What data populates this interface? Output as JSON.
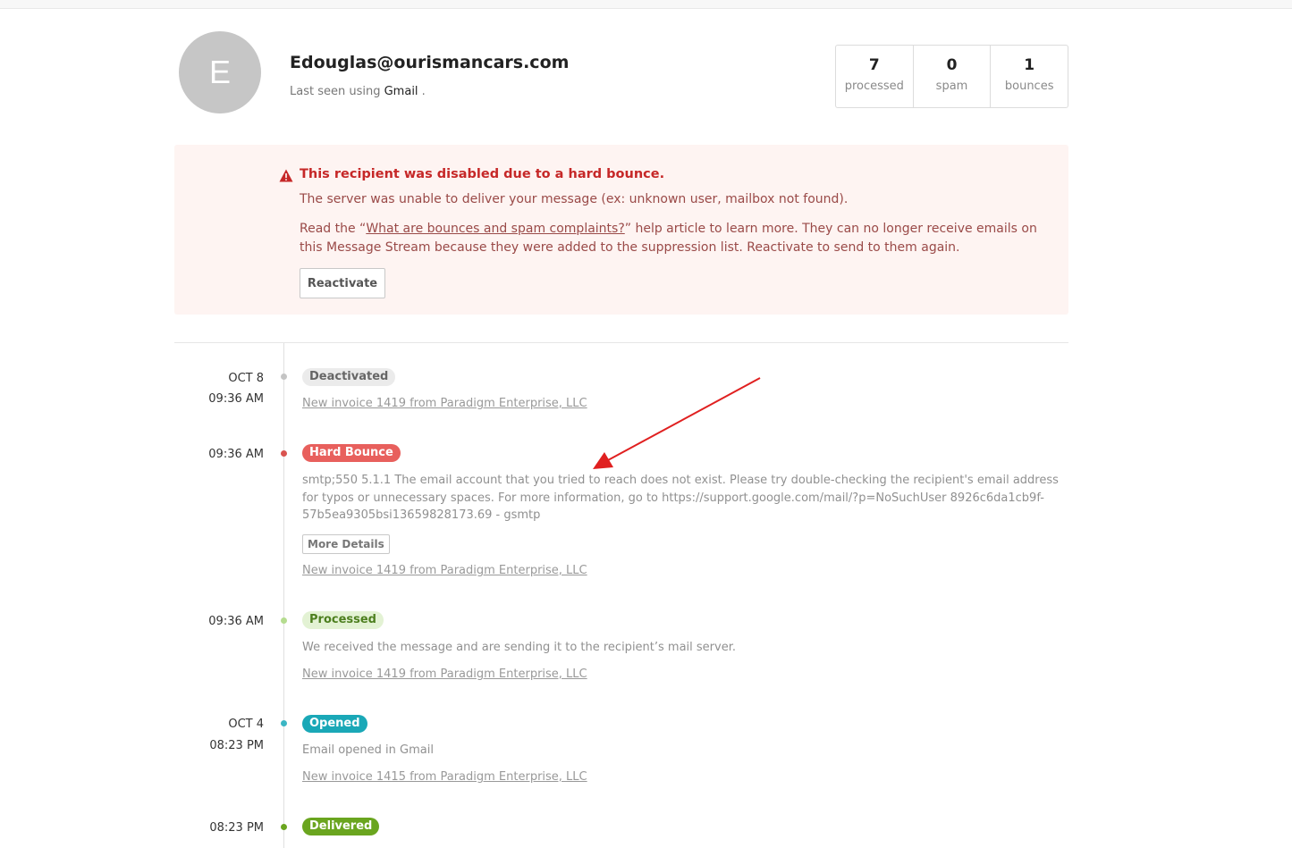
{
  "profile": {
    "avatar_letter": "E",
    "email": "Edouglas@ourismancars.com",
    "last_seen_prefix": "Last seen using",
    "last_seen_client": "Gmail",
    "last_seen_suffix": " ."
  },
  "stats": [
    {
      "value": "7",
      "label": "processed"
    },
    {
      "value": "0",
      "label": "spam"
    },
    {
      "value": "1",
      "label": "bounces"
    }
  ],
  "alert": {
    "icon": "warning-triangle-icon",
    "title": "This recipient was disabled due to a hard bounce.",
    "line1": "The server was unable to deliver your message (ex: unknown user, mailbox not found).",
    "line2_prefix": "Read the “",
    "line2_link": "What are bounces and spam complaints?",
    "line2_suffix": "” help article to learn more. They can no longer receive emails on this Message Stream because they were added to the suppression list. Reactivate to send to them again.",
    "button": "Reactivate",
    "colors": {
      "background": "#fef4f2",
      "title": "#c62828",
      "text": "#9a4a48"
    }
  },
  "timeline": [
    {
      "date": "OCT 8",
      "time": "09:36 AM",
      "badge": "Deactivated",
      "badge_color": "#ebebeb",
      "dot_color": "#c4c4c4",
      "link": "New invoice 1419 from Paradigm Enterprise, LLC"
    },
    {
      "time": "09:36 AM",
      "badge": "Hard Bounce",
      "badge_color": "#e8605d",
      "dot_color": "#d9534f",
      "description": "smtp;550 5.1.1 The email account that you tried to reach does not exist. Please try double-checking the recipient's email address for typos or unnecessary spaces. For more information, go to https://support.google.com/mail/?p=NoSuchUser 8926c6da1cb9f-57b5ea9305bsi13659828173.69 - gsmtp",
      "button": "More Details",
      "link": "New invoice 1419 from Paradigm Enterprise, LLC"
    },
    {
      "time": "09:36 AM",
      "badge": "Processed",
      "badge_color": "#e3f2d4",
      "dot_color": "#b5dc8f",
      "description": "We received the message and are sending it to the recipient’s mail server.",
      "link": "New invoice 1419 from Paradigm Enterprise, LLC"
    },
    {
      "date": "OCT 4",
      "time": "08:23 PM",
      "badge": "Opened",
      "badge_color": "#1aa8b7",
      "dot_color": "#3bb6c4",
      "description": "Email opened in Gmail",
      "link": "New invoice 1415 from Paradigm Enterprise, LLC"
    },
    {
      "time": "08:23 PM",
      "badge": "Delivered",
      "badge_color": "#6aa51f",
      "dot_color": "#6aa51f"
    }
  ],
  "annotation": {
    "arrow_color": "#e02020"
  }
}
